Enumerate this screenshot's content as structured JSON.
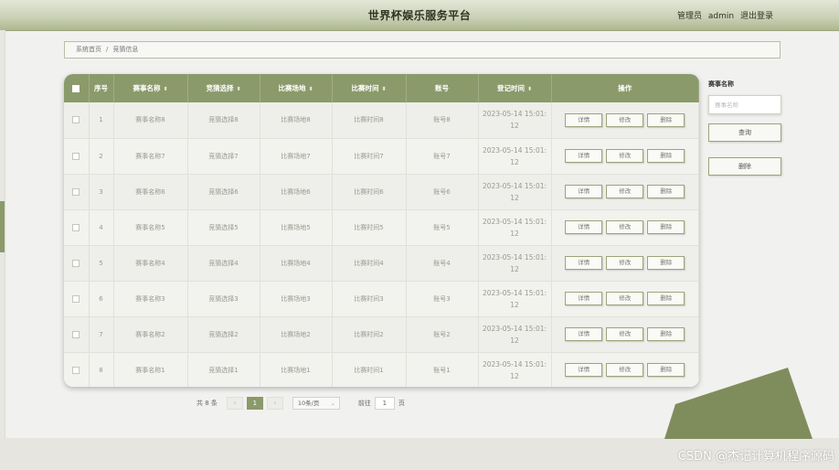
{
  "header": {
    "title": "世界杯娱乐服务平台",
    "role": "管理员",
    "username": "admin",
    "logout": "退出登录"
  },
  "breadcrumb": {
    "home": "系统首页",
    "separator": "/",
    "current": "竞猜信息"
  },
  "table": {
    "columns": [
      {
        "label": "",
        "sortable": false
      },
      {
        "label": "序号",
        "sortable": false
      },
      {
        "label": "赛事名称",
        "sortable": true
      },
      {
        "label": "竞猜选择",
        "sortable": true
      },
      {
        "label": "比赛场地",
        "sortable": true
      },
      {
        "label": "比赛时间",
        "sortable": true
      },
      {
        "label": "账号",
        "sortable": false
      },
      {
        "label": "登记时间",
        "sortable": true
      },
      {
        "label": "操作",
        "sortable": false
      }
    ],
    "rows": [
      {
        "index": "1",
        "event": "赛事名称8",
        "choice": "竞猜选择8",
        "venue": "比赛场地8",
        "match_time": "比赛时间8",
        "account": "账号8",
        "reg_time": "2023-05-14 15:01:12"
      },
      {
        "index": "2",
        "event": "赛事名称7",
        "choice": "竞猜选择7",
        "venue": "比赛场地7",
        "match_time": "比赛时间7",
        "account": "账号7",
        "reg_time": "2023-05-14 15:01:12"
      },
      {
        "index": "3",
        "event": "赛事名称6",
        "choice": "竞猜选择6",
        "venue": "比赛场地6",
        "match_time": "比赛时间6",
        "account": "账号6",
        "reg_time": "2023-05-14 15:01:12"
      },
      {
        "index": "4",
        "event": "赛事名称5",
        "choice": "竞猜选择5",
        "venue": "比赛场地5",
        "match_time": "比赛时间5",
        "account": "账号5",
        "reg_time": "2023-05-14 15:01:12"
      },
      {
        "index": "5",
        "event": "赛事名称4",
        "choice": "竞猜选择4",
        "venue": "比赛场地4",
        "match_time": "比赛时间4",
        "account": "账号4",
        "reg_time": "2023-05-14 15:01:12"
      },
      {
        "index": "6",
        "event": "赛事名称3",
        "choice": "竞猜选择3",
        "venue": "比赛场地3",
        "match_time": "比赛时间3",
        "account": "账号3",
        "reg_time": "2023-05-14 15:01:12"
      },
      {
        "index": "7",
        "event": "赛事名称2",
        "choice": "竞猜选择2",
        "venue": "比赛场地2",
        "match_time": "比赛时间2",
        "account": "账号2",
        "reg_time": "2023-05-14 15:01:12"
      },
      {
        "index": "8",
        "event": "赛事名称1",
        "choice": "竞猜选择1",
        "venue": "比赛场地1",
        "match_time": "比赛时间1",
        "account": "账号1",
        "reg_time": "2023-05-14 15:01:12"
      }
    ],
    "actions": {
      "detail": "详情",
      "edit": "修改",
      "delete": "删除"
    }
  },
  "search": {
    "label": "赛事名称",
    "placeholder": "赛事名称",
    "query_button": "查询",
    "delete_button": "删除"
  },
  "pagination": {
    "total": "共 8 条",
    "current_page": "1",
    "page_size": "10条/页",
    "jump_label": "前往",
    "jump_value": "1",
    "page_suffix": "页"
  },
  "watermark": "CSDN @杰记计算机程序源码",
  "colors": {
    "accent": "#8b9a6a",
    "header_gradient_start": "#e3e7d6",
    "header_gradient_end": "#aeb78f",
    "background": "#f1f1ef"
  },
  "icons": {
    "sort": "sort-caret-icon",
    "prev": "chevron-left-icon",
    "next": "chevron-right-icon",
    "dropdown": "chevron-down-icon"
  }
}
